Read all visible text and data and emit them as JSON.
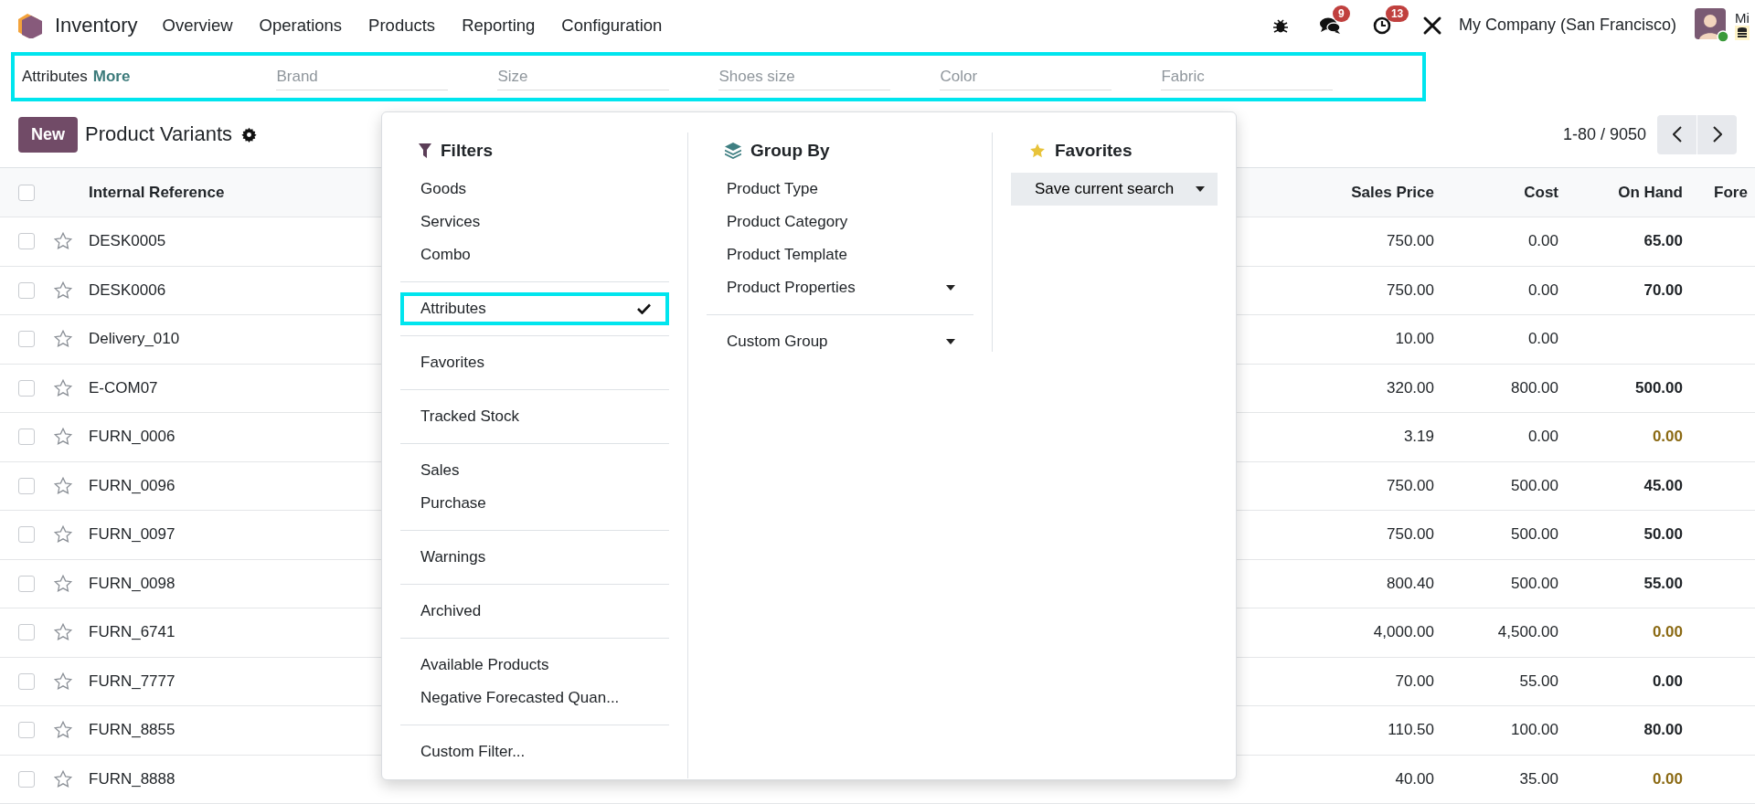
{
  "navbar": {
    "app": "Inventory",
    "menu": [
      "Overview",
      "Operations",
      "Products",
      "Reporting",
      "Configuration"
    ],
    "messages_badge": "9",
    "activities_badge": "13",
    "company": "My Company (San Francisco)",
    "user": "Mi"
  },
  "attribute_bar": {
    "highlighted": true,
    "label": "Attributes",
    "more": "More",
    "fields": [
      {
        "placeholder": "Brand"
      },
      {
        "placeholder": "Size"
      },
      {
        "placeholder": "Shoes size"
      },
      {
        "placeholder": "Color"
      },
      {
        "placeholder": "Fabric"
      }
    ]
  },
  "control_panel": {
    "new_button": "New",
    "title": "Product Variants",
    "pager": "1-80 / 9050"
  },
  "table": {
    "all_checked": false,
    "columns": [
      "Internal Reference",
      "Sales Price",
      "Cost",
      "On Hand",
      "Fore"
    ],
    "rows": [
      {
        "checked": false,
        "ref": "DESK0005",
        "price": "750.00",
        "cost": "0.00",
        "on_hand": "65.00",
        "warning": false
      },
      {
        "checked": false,
        "ref": "DESK0006",
        "price": "750.00",
        "cost": "0.00",
        "on_hand": "70.00",
        "warning": false
      },
      {
        "checked": false,
        "ref": "Delivery_010",
        "price": "10.00",
        "cost": "0.00"
      },
      {
        "checked": false,
        "ref": "E-COM07",
        "price": "320.00",
        "cost": "800.00",
        "on_hand": "500.00",
        "warning": false
      },
      {
        "checked": false,
        "ref": "FURN_0006",
        "price": "3.19",
        "cost": "0.00",
        "on_hand": "0.00",
        "warning": true
      },
      {
        "checked": false,
        "ref": "FURN_0096",
        "price": "750.00",
        "cost": "500.00",
        "on_hand": "45.00",
        "warning": false
      },
      {
        "checked": false,
        "ref": "FURN_0097",
        "price": "750.00",
        "cost": "500.00",
        "on_hand": "50.00",
        "warning": false
      },
      {
        "checked": false,
        "ref": "FURN_0098",
        "price": "800.40",
        "cost": "500.00",
        "on_hand": "55.00",
        "warning": false
      },
      {
        "checked": false,
        "ref": "FURN_6741",
        "price": "4,000.00",
        "cost": "4,500.00",
        "on_hand": "0.00",
        "warning": true
      },
      {
        "checked": false,
        "ref": "FURN_7777",
        "price": "70.00",
        "cost": "55.00",
        "on_hand": "0.00",
        "warning": false
      },
      {
        "checked": false,
        "ref": "FURN_8855",
        "price": "110.50",
        "cost": "100.00",
        "on_hand": "80.00",
        "warning": false
      },
      {
        "checked": false,
        "ref": "FURN_8888",
        "price": "40.00",
        "cost": "35.00",
        "on_hand": "0.00",
        "warning": true
      }
    ]
  },
  "dropdown": {
    "filters": {
      "title": "Filters",
      "groups": [
        [
          {
            "label": "Goods",
            "checked": false,
            "highlighted": false
          },
          {
            "label": "Services",
            "checked": false,
            "highlighted": false
          },
          {
            "label": "Combo",
            "checked": false,
            "highlighted": false
          }
        ],
        [
          {
            "label": "Attributes",
            "checked": true,
            "highlighted": true
          }
        ],
        [
          {
            "label": "Favorites",
            "checked": false,
            "highlighted": false
          }
        ],
        [
          {
            "label": "Tracked Stock",
            "checked": false,
            "highlighted": false
          }
        ],
        [
          {
            "label": "Sales",
            "checked": false,
            "highlighted": false
          },
          {
            "label": "Purchase",
            "checked": false,
            "highlighted": false
          }
        ],
        [
          {
            "label": "Warnings",
            "checked": false,
            "highlighted": false
          }
        ],
        [
          {
            "label": "Archived",
            "checked": false,
            "highlighted": false
          }
        ],
        [
          {
            "label": "Available Products",
            "checked": false,
            "highlighted": false
          },
          {
            "label": "Negative Forecasted Quan...",
            "checked": false,
            "highlighted": false
          }
        ],
        [
          {
            "label": "Custom Filter...",
            "checked": false,
            "highlighted": false
          }
        ]
      ]
    },
    "group_by": {
      "title": "Group By",
      "groups": [
        [
          {
            "label": "Product Type",
            "kind": "option"
          },
          {
            "label": "Product Category",
            "kind": "option"
          },
          {
            "label": "Product Template",
            "kind": "option"
          },
          {
            "label": "Product Properties",
            "kind": "submenu"
          }
        ],
        [
          {
            "label": "Custom Group",
            "kind": "submenu"
          }
        ]
      ]
    },
    "favorites": {
      "title": "Favorites",
      "save": "Save current search"
    }
  }
}
